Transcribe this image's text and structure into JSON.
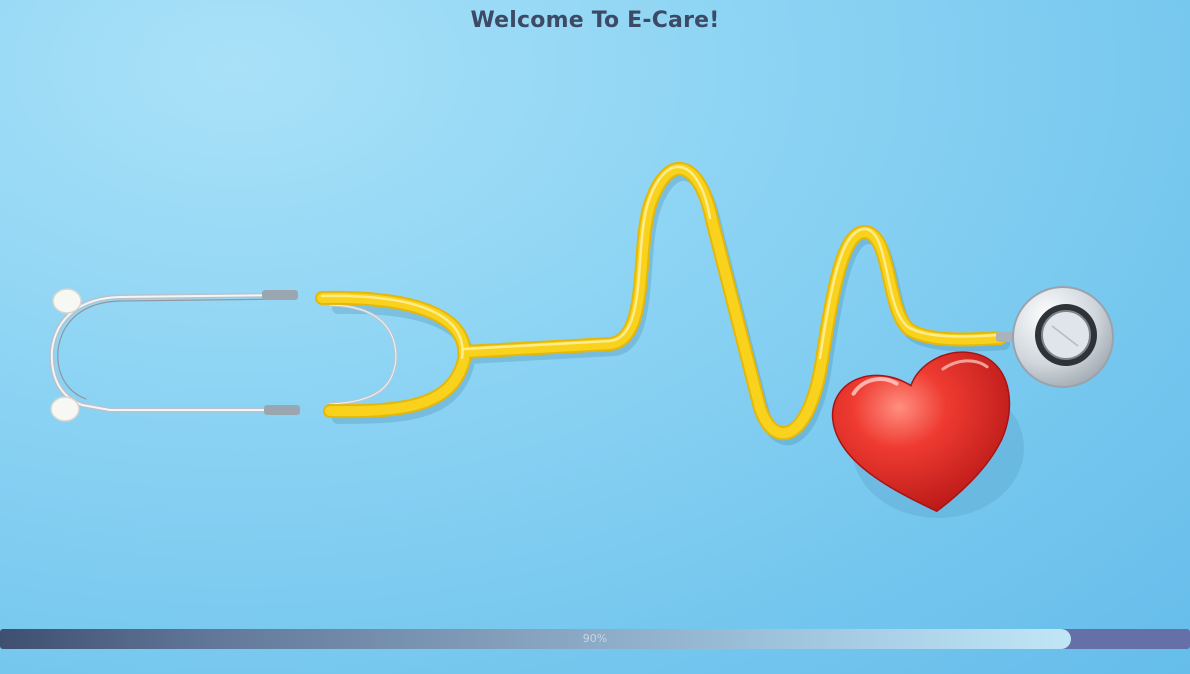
{
  "header": {
    "title": "Welcome To E-Care!"
  },
  "illustration": {
    "subject": "stethoscope-with-heart"
  },
  "progress": {
    "value": 0.9,
    "label": "90%"
  },
  "colors": {
    "background": "#74c6ee",
    "title": "#3c4a66",
    "tube": "#f6cf16",
    "heart": "#e3302b",
    "progress_track": "#6470a7",
    "progress_fill_start": "#3e4f70",
    "progress_fill_end": "#c0e6f6"
  }
}
